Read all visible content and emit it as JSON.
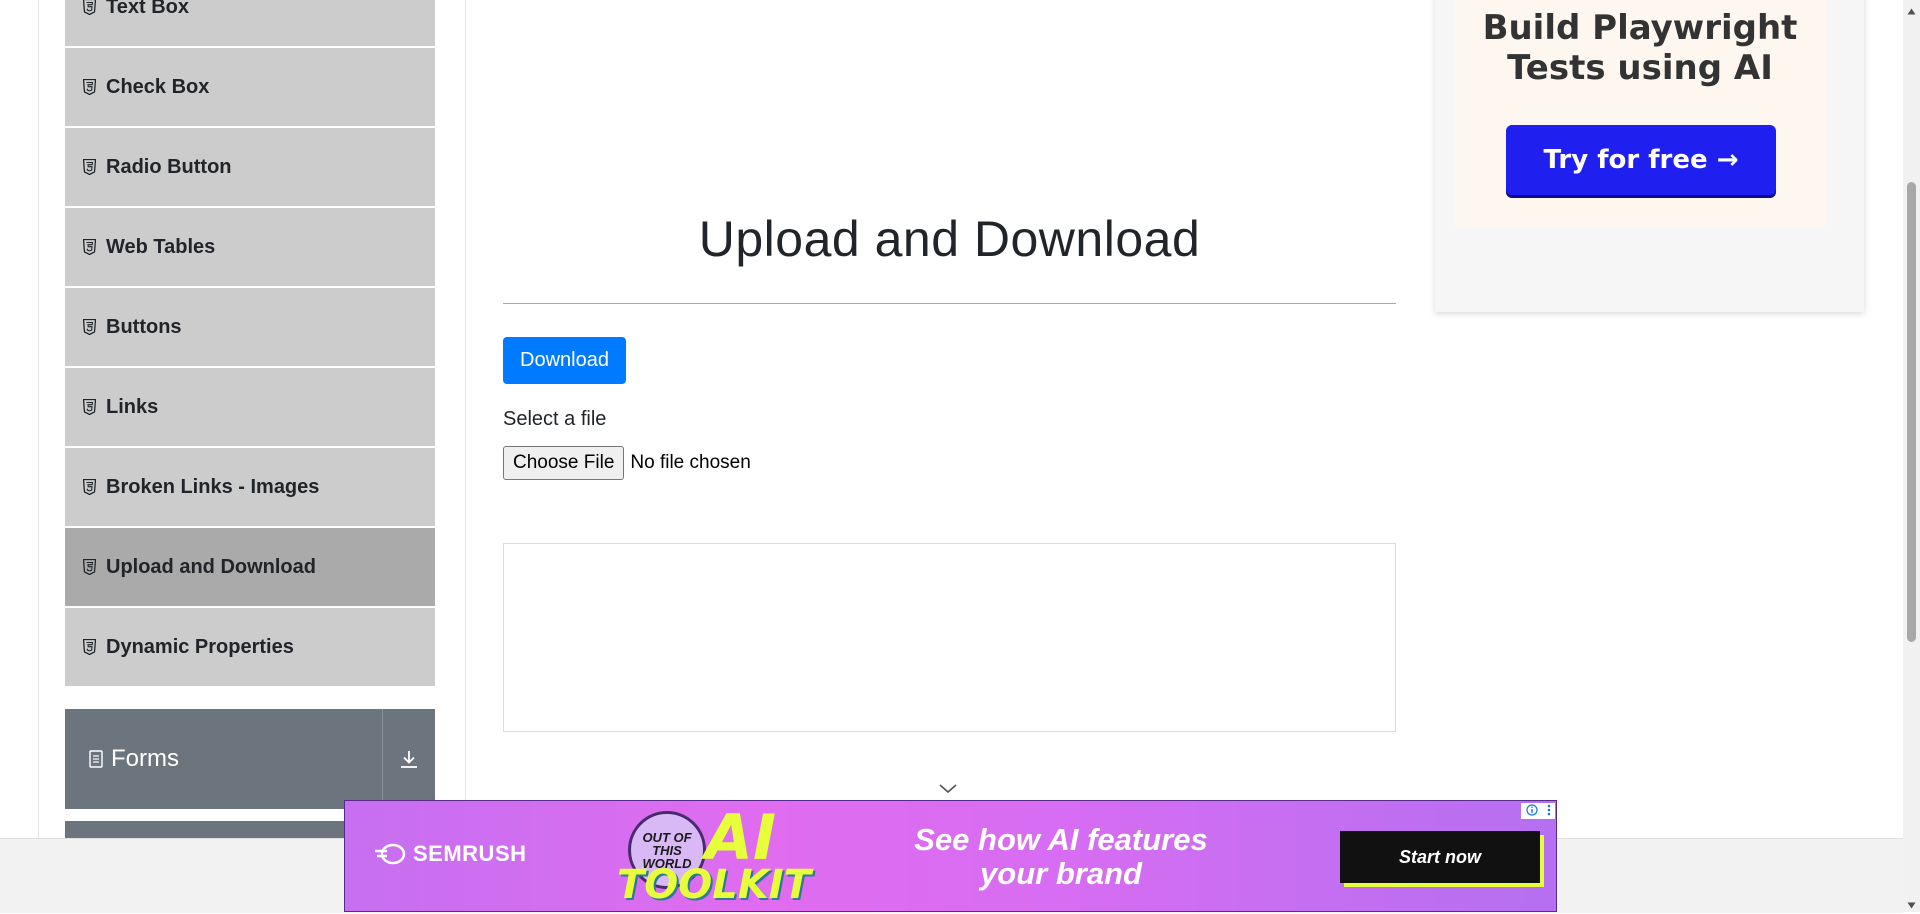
{
  "sidebar": {
    "items": [
      {
        "label": "Text Box"
      },
      {
        "label": "Check Box"
      },
      {
        "label": "Radio Button"
      },
      {
        "label": "Web Tables"
      },
      {
        "label": "Buttons"
      },
      {
        "label": "Links"
      },
      {
        "label": "Broken Links - Images"
      },
      {
        "label": "Upload and Download",
        "active": true
      },
      {
        "label": "Dynamic Properties"
      }
    ],
    "group": {
      "label": "Forms",
      "icon": "document-icon",
      "toggle_icon": "download-arrow-icon"
    }
  },
  "main": {
    "title": "Upload and Download",
    "download_button": "Download",
    "select_label": "Select a file",
    "choose_button": "Choose File",
    "file_status": "No file chosen"
  },
  "ad_card": {
    "headline_line1": "Build Playwright",
    "headline_line2": "Tests using AI",
    "cta": "Try for free →"
  },
  "banner": {
    "brand": "SEMRUSH",
    "badge_line1": "OUT OF THIS",
    "badge_line2": "WORLD",
    "big_text": "AI",
    "toolkit": "TOOLKIT",
    "tagline_line1": "See how AI features",
    "tagline_line2": "your brand",
    "cta": "Start now"
  },
  "colors": {
    "primary_button": "#007bff",
    "menu_item_bg": "#cccccc",
    "menu_item_active_bg": "#aaaaaa",
    "group_header_bg": "#6c757d",
    "ad_cta_bg": "#1f1ff0"
  }
}
